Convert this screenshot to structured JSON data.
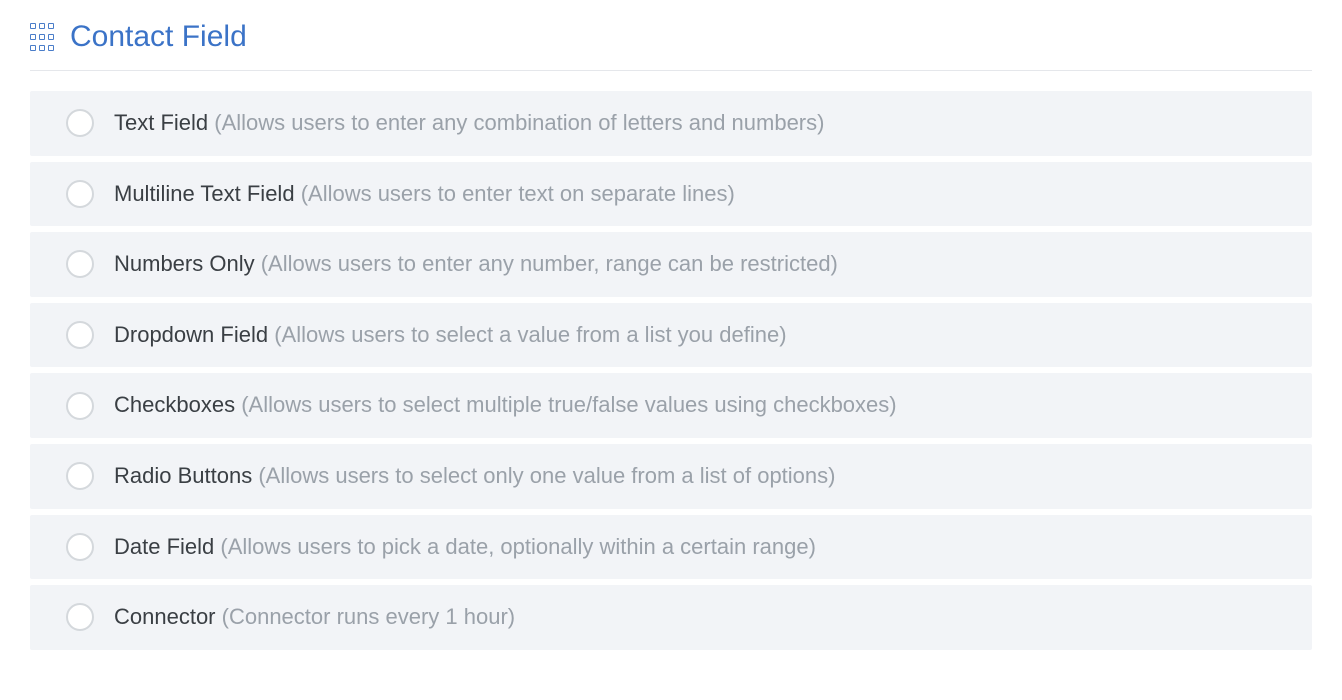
{
  "header": {
    "title": "Contact Field"
  },
  "options": [
    {
      "name": "Text Field",
      "description": "(Allows users to enter any combination of letters and numbers)"
    },
    {
      "name": "Multiline Text Field",
      "description": "(Allows users to enter text on separate lines)"
    },
    {
      "name": "Numbers Only",
      "description": "(Allows users to enter any number, range can be restricted)"
    },
    {
      "name": "Dropdown Field",
      "description": "(Allows users to select a value from a list you define)"
    },
    {
      "name": "Checkboxes",
      "description": "(Allows users to select multiple true/false values using checkboxes)"
    },
    {
      "name": "Radio Buttons",
      "description": "(Allows users to select only one value from a list of options)"
    },
    {
      "name": "Date Field",
      "description": "(Allows users to pick a date, optionally within a certain range)"
    },
    {
      "name": "Connector",
      "description": "(Connector runs every 1 hour)"
    }
  ]
}
